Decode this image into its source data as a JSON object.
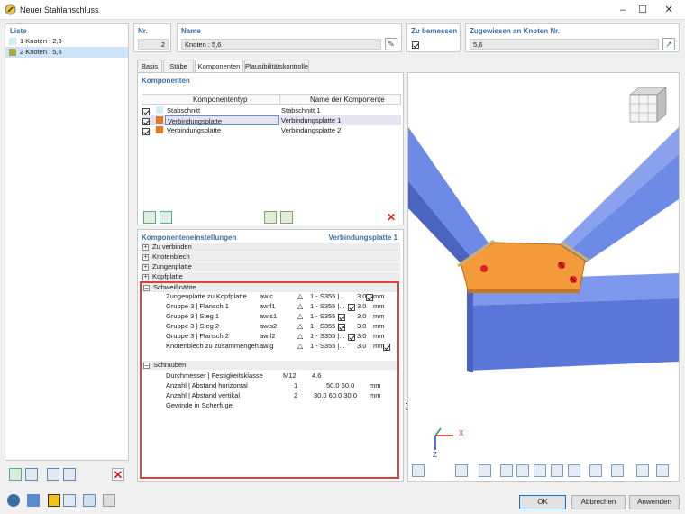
{
  "window": {
    "title": "Neuer Stahlanschluss"
  },
  "liste": {
    "header": "Liste",
    "items": [
      {
        "label": "1  Knoten : 2,3",
        "color": "#cfeef0"
      },
      {
        "label": "2  Knoten : 5,6",
        "color": "#a9a948"
      }
    ]
  },
  "top": {
    "nr_label": "Nr.",
    "nr_value": "2",
    "name_label": "Name",
    "name_value": "Knoten : 5,6",
    "bemessen_label": "Zu bemessen",
    "zugewiesen_label": "Zugewiesen an Knoten Nr.",
    "zugewiesen_value": "5,6"
  },
  "tabs": [
    "Basis",
    "Stäbe",
    "Komponenten",
    "Plausibilitätskontrolle"
  ],
  "komponenten": {
    "header": "Komponenten",
    "col_typ": "Komponententyp",
    "col_name": "Name der Komponente",
    "rows": [
      {
        "typ": "Stabschnitt",
        "name": "Stabschnitt 1",
        "color": "#cfeef8"
      },
      {
        "typ": "Verbindungsplatte",
        "name": "Verbindungsplatte 1",
        "color": "#e87722"
      },
      {
        "typ": "Verbindungsplatte",
        "name": "Verbindungsplatte 2",
        "color": "#e87722"
      }
    ]
  },
  "einstellungen": {
    "header": "Komponenteneinstellungen",
    "right": "Verbindungsplatte 1",
    "groups": [
      "Zu verbinden",
      "Knotenblech",
      "Zungenplatte",
      "Kopfplatte"
    ],
    "schweiss_header": "Schweißnähte",
    "welds": [
      {
        "label": "Zungenplatte zu Kopfplatte",
        "sym": "aw,c",
        "mat": "1 - S355 |...",
        "val": "3.0",
        "unit": "mm"
      },
      {
        "label": "Gruppe 3 | Flansch 1",
        "sym": "aw,f1",
        "mat": "1 - S355 |...",
        "val": "3.0",
        "unit": "mm"
      },
      {
        "label": "Gruppe 3 | Steg 1",
        "sym": "aw,s1",
        "mat": "1 - S355 |...",
        "val": "3.0",
        "unit": "mm"
      },
      {
        "label": "Gruppe 3 | Steg 2",
        "sym": "aw,s2",
        "mat": "1 - S355 |...",
        "val": "3.0",
        "unit": "mm"
      },
      {
        "label": "Gruppe 3 | Flansch 2",
        "sym": "aw,f2",
        "mat": "1 - S355 |...",
        "val": "3.0",
        "unit": "mm"
      },
      {
        "label": "Knotenblech zu zusammengeh...",
        "sym": "aw,g",
        "mat": "1 - S355 |...",
        "val": "3.0",
        "unit": "mm"
      }
    ],
    "schrauben_header": "Schrauben",
    "bolts": [
      {
        "label": "Durchmesser | Festigkeitsklasse",
        "a": "M12",
        "b": "4.6",
        "unit": ""
      },
      {
        "label": "Anzahl | Abstand horizontal",
        "a": "1",
        "b": "50.0 60.0",
        "unit": "mm"
      },
      {
        "label": "Anzahl | Abstand vertikal",
        "a": "2",
        "b": "30.0 60.0 30.0",
        "unit": "mm"
      },
      {
        "label": "Gewinde in Scherfuge",
        "a": "",
        "b": "",
        "unit": ""
      }
    ]
  },
  "axes": {
    "x": "X",
    "z": "Z"
  },
  "buttons": {
    "ok": "OK",
    "cancel": "Abbrechen",
    "apply": "Anwenden"
  },
  "colors": {
    "accent": "#3b6ea5",
    "highlight": "#e04040",
    "plate": "#f39a3a",
    "beam": "#5b7fe0"
  }
}
